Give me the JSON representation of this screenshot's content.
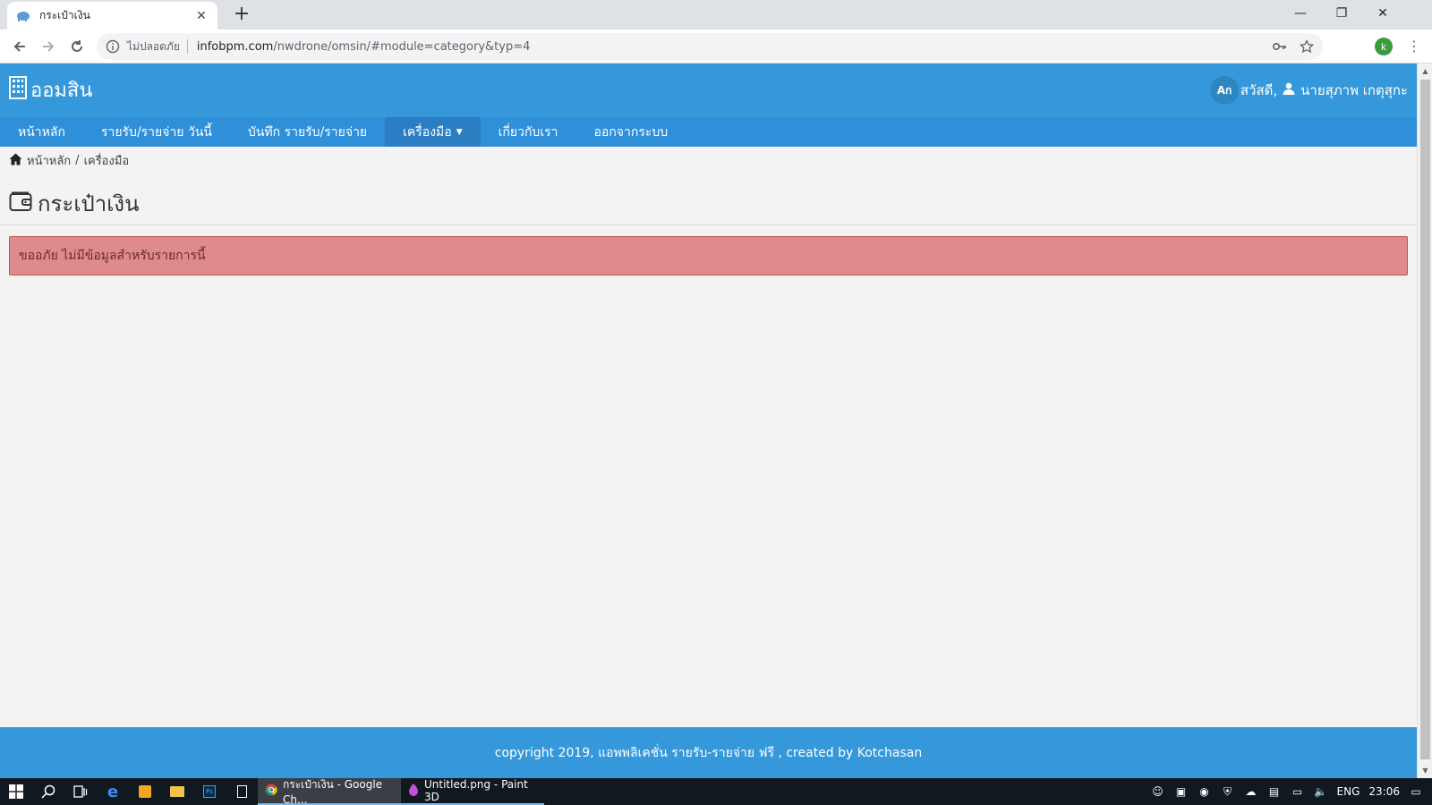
{
  "browser": {
    "tab_title": "กระเป๋าเงิน",
    "new_tab": "+",
    "insecure_label": "ไม่ปลอดภัย",
    "url_host": "infobpm.com",
    "url_path": "/nwdrone/omsin/#module=category&typ=4",
    "profile_initial": "k"
  },
  "app": {
    "brand": "ออมสิน",
    "lang_button": "Aก",
    "greeting": "สวัสดี,",
    "user_name": "นายสุภาพ เกตุสุกะ"
  },
  "nav": {
    "items": [
      {
        "label": "หน้าหลัก"
      },
      {
        "label": "รายรับ/รายจ่าย วันนี้"
      },
      {
        "label": "บันทึก รายรับ/รายจ่าย"
      },
      {
        "label": "เครื่องมือ"
      },
      {
        "label": "เกี่ยวกับเรา"
      },
      {
        "label": "ออกจากระบบ"
      }
    ]
  },
  "breadcrumb": {
    "home": "หน้าหลัก",
    "separator": "/",
    "current": "เครื่องมือ"
  },
  "page": {
    "title": "กระเป๋าเงิน",
    "alert": "ขออภัย ไม่มีข้อมูลสำหรับรายการนี้"
  },
  "footer": {
    "text": "copyright 2019, แอพพลิเคชั่น รายรับ-รายจ่าย ฟรี , created by Kotchasan"
  },
  "taskbar": {
    "apps": [
      {
        "label": "กระเป๋าเงิน - Google Ch..."
      },
      {
        "label": "Untitled.png - Paint 3D"
      }
    ],
    "language": "ENG",
    "time": "23:06"
  },
  "colors": {
    "header": "#3498db",
    "nav": "#2f8fd8",
    "alert_bg": "#e08b8b",
    "page_bg": "#f3f3f3"
  }
}
